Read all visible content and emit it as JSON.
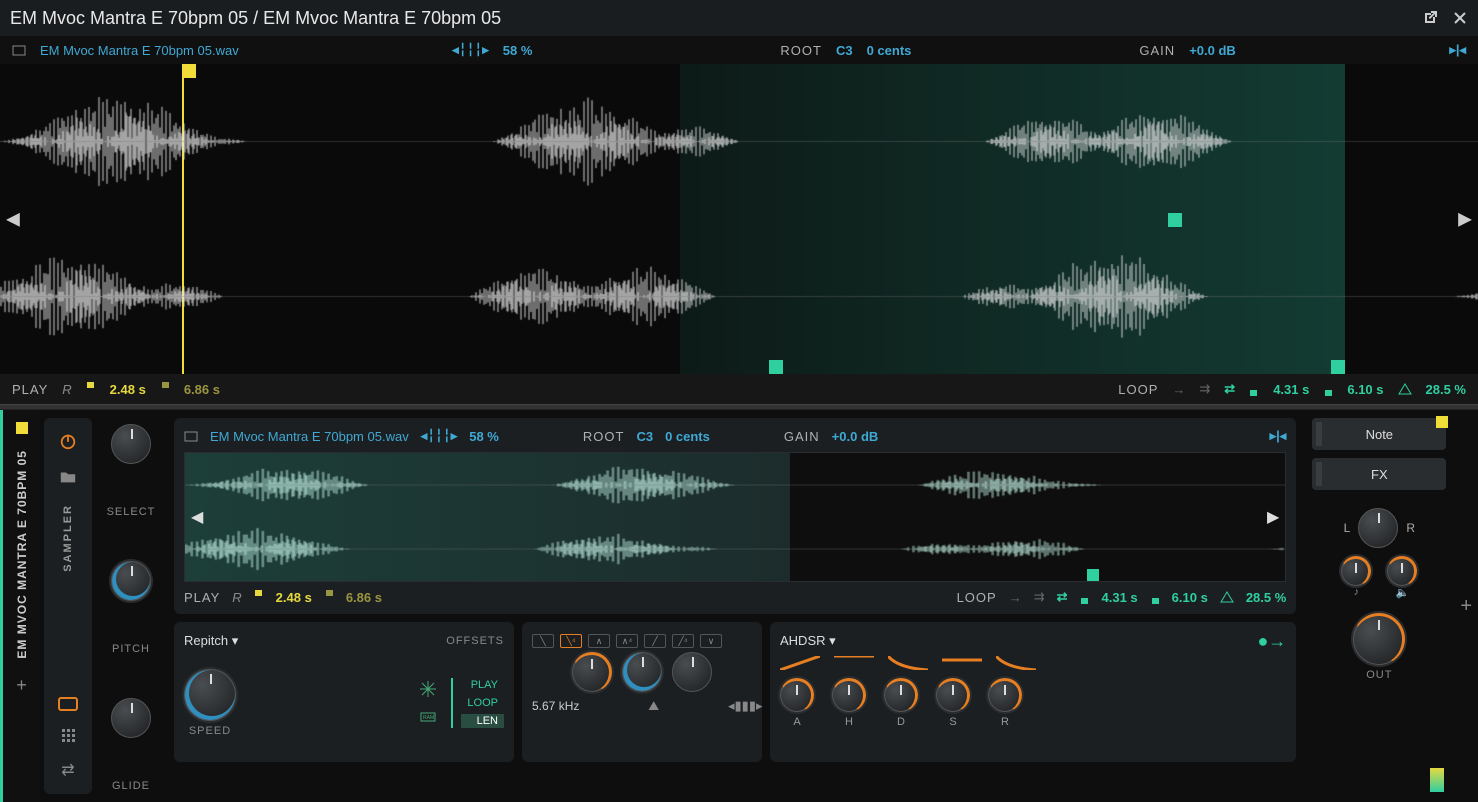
{
  "title": "EM Mvoc Mantra E 70bpm 05 / EM Mvoc Mantra E 70bpm 05",
  "file": "EM Mvoc Mantra E 70bpm 05.wav",
  "stretch": "58 %",
  "root_label": "ROOT",
  "root_note": "C3",
  "root_cents": "0 cents",
  "gain_label": "GAIN",
  "gain_value": "+0.0 dB",
  "play_label": "PLAY",
  "play_start": "2.48 s",
  "play_end": "6.86 s",
  "loop_label": "LOOP",
  "loop_start": "4.31 s",
  "loop_end": "6.10 s",
  "loop_xfade": "28.5 %",
  "sidebar_title": "EM MVOC MANTRA E 70BPM 05",
  "sampler_label": "SAMPLER",
  "knobs": {
    "select": "SELECT",
    "pitch": "PITCH",
    "glide": "GLIDE",
    "speed": "SPEED",
    "out": "OUT"
  },
  "repitch": {
    "title": "Repitch",
    "offsets_label": "OFFSETS",
    "play": "PLAY",
    "loop": "LOOP",
    "len": "LEN"
  },
  "filter": {
    "freq": "5.67 kHz"
  },
  "env": {
    "title": "AHDSR",
    "a": "A",
    "h": "H",
    "d": "D",
    "s": "S",
    "r": "R"
  },
  "right": {
    "note": "Note",
    "fx": "FX",
    "l": "L",
    "r": "R"
  }
}
